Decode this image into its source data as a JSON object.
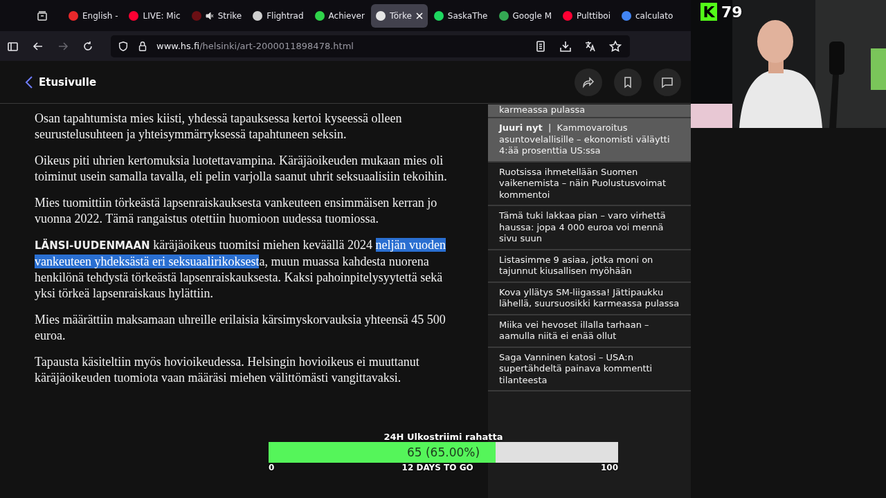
{
  "browser": {
    "tabs": [
      {
        "label": "English -",
        "color": "#e8282b",
        "selected": false,
        "muted": false
      },
      {
        "label": "LIVE: Mic",
        "color": "#ff0033",
        "selected": false,
        "muted": false
      },
      {
        "label": "Strike",
        "color": "#6b0f14",
        "selected": false,
        "muted": true
      },
      {
        "label": "Flightrad",
        "color": "#cfcfcf",
        "selected": false,
        "muted": false
      },
      {
        "label": "Achiever",
        "color": "#2fd34a",
        "selected": false,
        "muted": false
      },
      {
        "label": "Törke",
        "color": "#e6e6e6",
        "selected": true,
        "muted": false
      },
      {
        "label": "SaskaThe",
        "color": "#1ed760",
        "selected": false,
        "muted": false
      },
      {
        "label": "Google M",
        "color": "#34a853",
        "selected": false,
        "muted": false
      },
      {
        "label": "Pulttiboi",
        "color": "#ff0033",
        "selected": false,
        "muted": false
      },
      {
        "label": "calculato",
        "color": "#4285f4",
        "selected": false,
        "muted": false
      }
    ],
    "url_host": "www.hs.fi",
    "url_path": "/helsinki/art-2000011898478.html"
  },
  "header": {
    "back_label": "Etusivulle"
  },
  "article": {
    "paragraphs": [
      [
        {
          "kind": "plain",
          "text": "Osan tapahtumista mies kiisti, yhdessä tapauksessa kertoi kyseessä olleen seurustelusuhteen ja yhteisymmärryksessä tapahtuneen seksin."
        }
      ],
      [
        {
          "kind": "plain",
          "text": "Oikeus piti uhrien kertomuksia luotettavampina. Käräjäoikeuden mukaan mies oli toiminut usein samalla tavalla, eli pelin varjolla saanut uhrit seksuaalisiin tekoihin."
        }
      ],
      [
        {
          "kind": "plain",
          "text": "Mies tuomittiin törkeästä lapsenraiskauksesta vankeuteen ensimmäisen kerran jo vuonna 2022. Tämä rangaistus otettiin huomioon uudessa tuomiossa."
        }
      ],
      [
        {
          "kind": "lead",
          "text": "LÄNSI-UUDENMAAN"
        },
        {
          "kind": "plain",
          "text": " käräjäoikeus tuomitsi miehen keväällä 2024 "
        },
        {
          "kind": "selected",
          "text": "neljän vuoden vankeuteen yhdeksästä eri seksuaalirikoksest"
        },
        {
          "kind": "plain",
          "text": "a, muun muassa kahdesta nuorena henkilönä tehdystä törkeästä lapsenraiskauksesta. Kaksi pahoinpitelysyytettä sekä yksi törkeä lapsenraiskaus hylättiin."
        }
      ],
      [
        {
          "kind": "plain",
          "text": "Mies määrättiin maksamaan uhreille erilaisia kärsimyskorvauksia yhteensä 45 500 euroa."
        }
      ],
      [
        {
          "kind": "plain",
          "text": "Tapausta käsiteltiin myös hovioikeudessa. Helsingin hovioikeus ei muuttanut käräjäoikeuden tuomiota vaan määräsi miehen välittömästi vangittavaksi."
        }
      ]
    ]
  },
  "sidebar": {
    "items": [
      {
        "label": "karmeassa pulassa",
        "selected": true
      },
      {
        "tag": "Juuri nyt",
        "separator": "|",
        "label": "Kammovaroitus asuntovelallisille – ekonomisti väläytti 4:ää prosenttia US:ssa",
        "selected": true
      },
      {
        "label": "Ruotsissa ihmetellään Suomen vaikenemista – näin Puolustusvoimat kommentoi",
        "selected": false
      },
      {
        "label": "Tämä tuki lakkaa pian – varo virhettä haussa: jopa 4 000 euroa voi mennä sivu suun",
        "selected": false
      },
      {
        "label": "Listasimme 9 asiaa, jotka moni on tajunnut kiusallisen myöhään",
        "selected": false
      },
      {
        "label": "Kova yllätys SM-liigassa! Jättipaukku lähellä, suursuosikki karmeassa pulassa",
        "selected": false
      },
      {
        "label": "Miika vei hevoset illalla tarhaan – aamulla niitä ei enää ollut",
        "selected": false
      },
      {
        "label": "Saga Vanninen katosi – USA:n supertähdeltä painava kommentti tilanteesta",
        "selected": false
      }
    ]
  },
  "stream": {
    "logo": "K",
    "count": "79",
    "goal": {
      "title": "24H Ulkostriimi rahatta",
      "level": 0.65,
      "reading": "65 (65.00%)",
      "min": "0",
      "center": "12 DAYS TO GO",
      "max": "100"
    }
  }
}
